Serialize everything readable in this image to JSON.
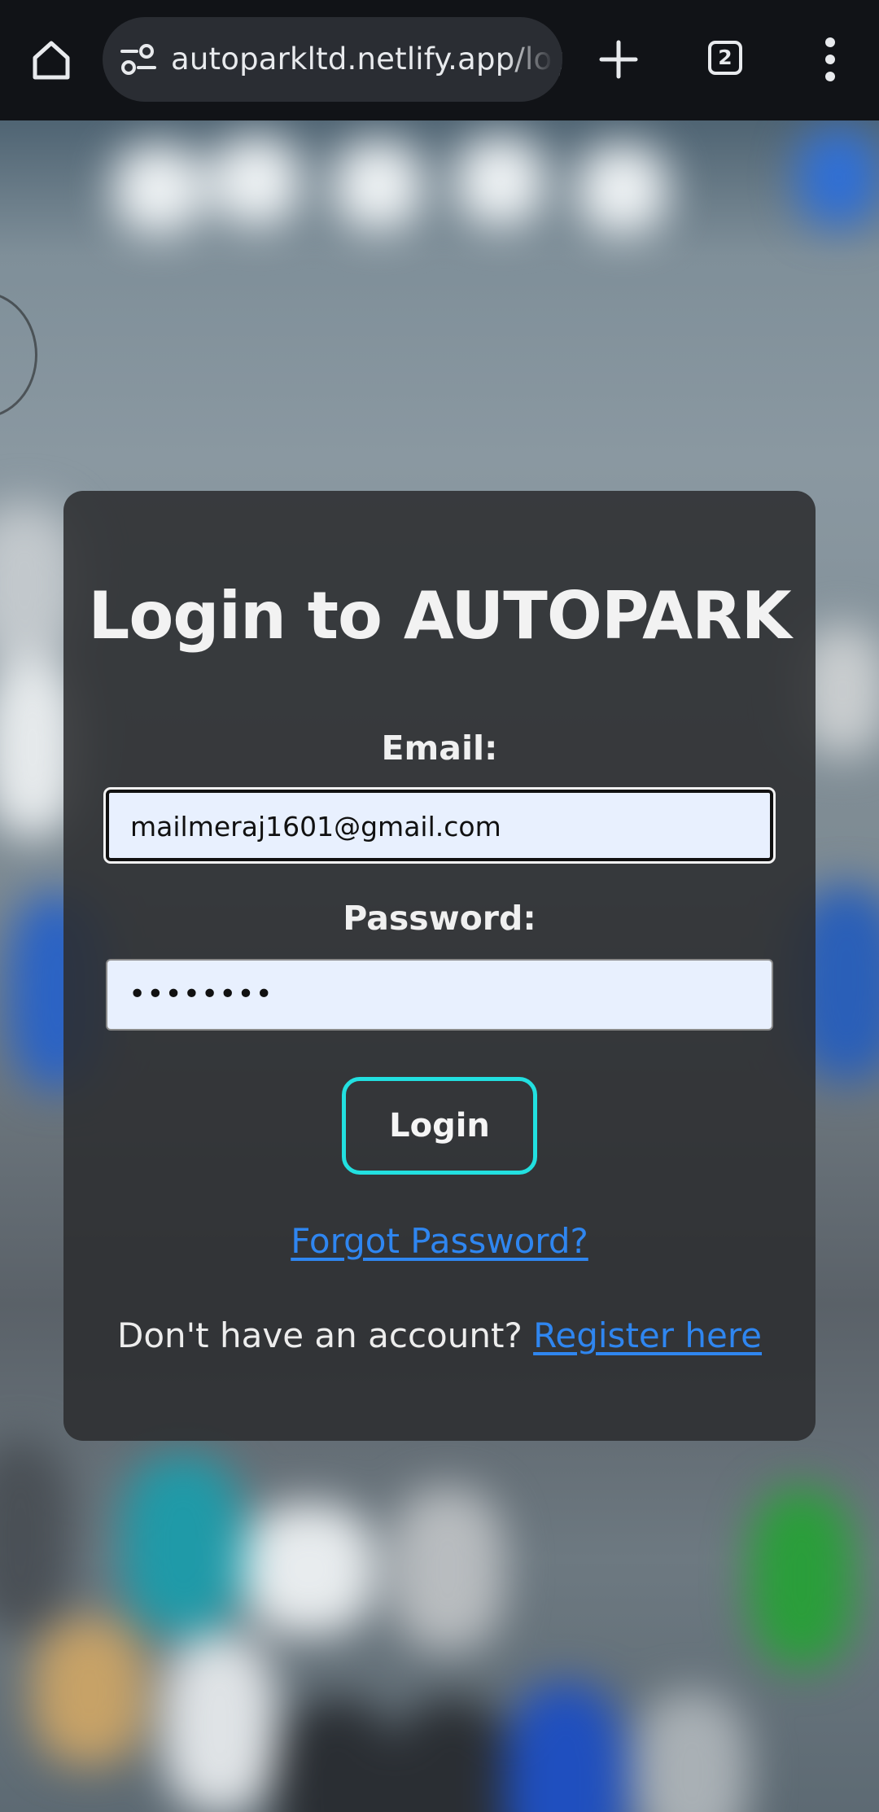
{
  "browser": {
    "url": "autoparkltd.netlify.app/log",
    "tab_count": "2",
    "icons": {
      "home": "home-icon",
      "site_info": "site-info-icon",
      "new_tab": "plus-icon",
      "tabs": "tab-switcher-icon",
      "menu": "more-vert-icon"
    }
  },
  "login": {
    "title": "Login to AUTOPARK",
    "email_label": "Email:",
    "email_value": "mailmeraj1601@gmail.com",
    "password_label": "Password:",
    "password_masked": "••••••••",
    "login_button": "Login",
    "forgot_password": "Forgot Password?",
    "register_prompt": "Don't have an account?",
    "register_link": "Register here"
  },
  "colors": {
    "browser_bar": "#111317",
    "url_pill": "#2a2d33",
    "card": "#2c2e30",
    "input_background": "#e8f0fe",
    "login_button_border": "#22e0e0",
    "link": "#2f86f0"
  }
}
